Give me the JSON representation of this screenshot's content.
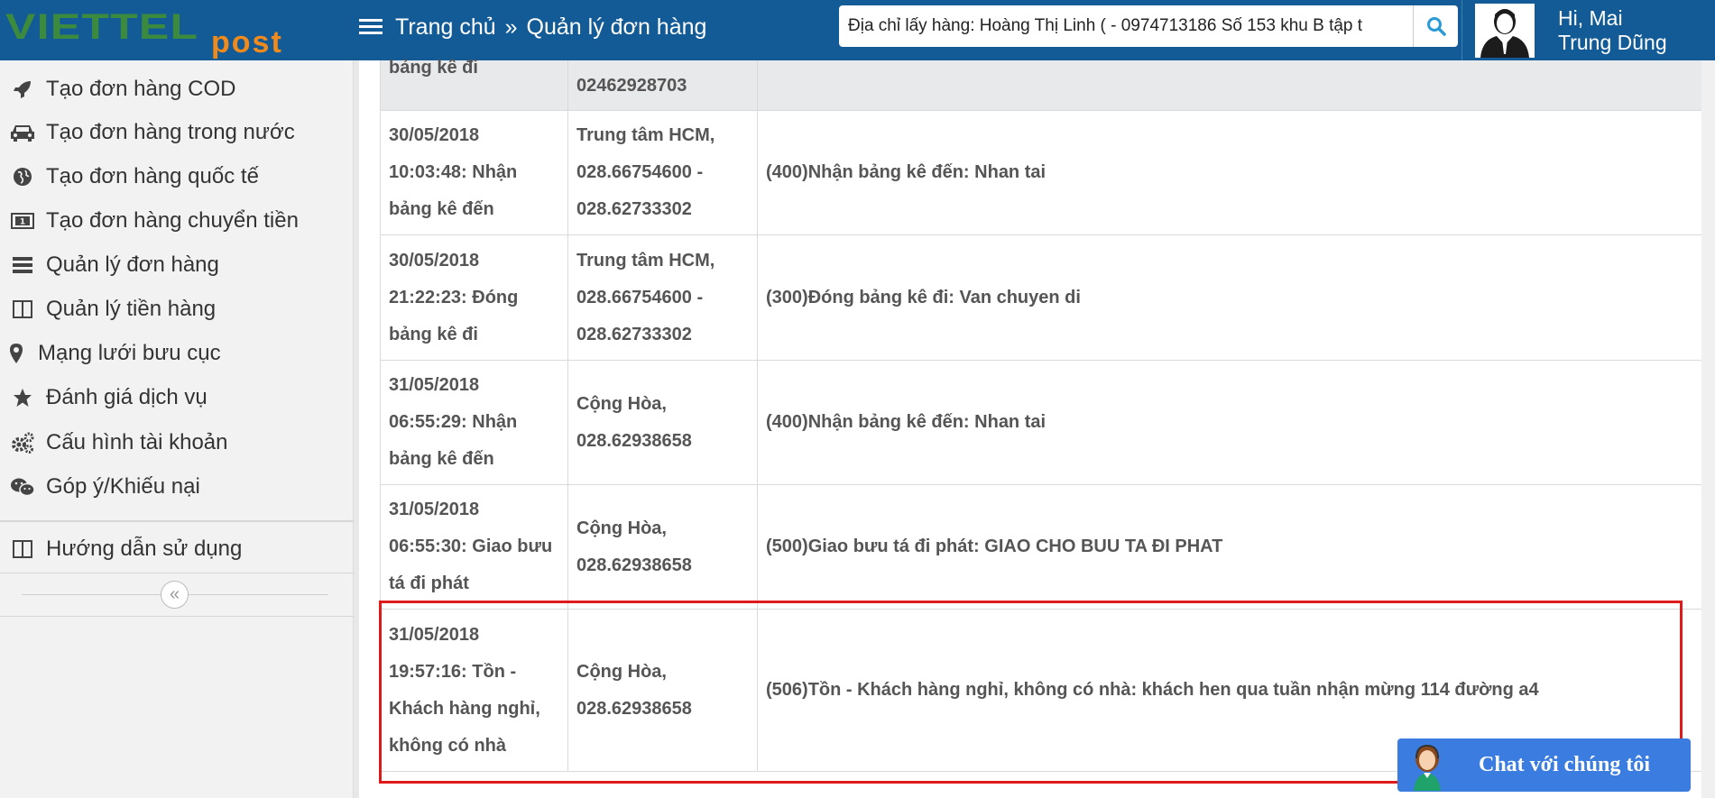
{
  "header": {
    "logo_primary": "VIETTEL",
    "logo_secondary": "post",
    "breadcrumb": [
      "Trang chủ",
      "Quản lý đơn hàng"
    ],
    "breadcrumb_sep": "»",
    "search_value": "Địa chỉ lấy hàng: Hoàng Thị Linh ( - 0974713186 Số 153 khu B tập t",
    "greeting_line1": "Hi, Mai",
    "greeting_line2": "Trung Dũng"
  },
  "sidebar": {
    "items": [
      {
        "label": "Tạo đơn hàng COD",
        "icon": "rocket-icon"
      },
      {
        "label": "Tạo đơn hàng trong nước",
        "icon": "car-icon"
      },
      {
        "label": "Tạo đơn hàng quốc tế",
        "icon": "globe-icon"
      },
      {
        "label": "Tạo đơn hàng chuyển tiền",
        "icon": "money-icon"
      },
      {
        "label": "Quản lý đơn hàng",
        "icon": "list-icon"
      },
      {
        "label": "Quản lý tiền hàng",
        "icon": "columns-icon"
      },
      {
        "label": "Mạng lưới bưu cục",
        "icon": "map-marker-icon"
      },
      {
        "label": "Đánh giá dịch vụ",
        "icon": "star-icon"
      },
      {
        "label": "Cấu hình tài khoản",
        "icon": "cogs-icon"
      },
      {
        "label": "Góp ý/Khiếu nại",
        "icon": "wechat-icon"
      }
    ],
    "guide": {
      "label": "Hướng dẫn sử dụng",
      "icon": "book-icon"
    },
    "collapse_glyph": "«"
  },
  "table": {
    "first_row": {
      "col1": "bảng kê đi",
      "col2": "02462928703",
      "col3": ""
    },
    "rows": [
      {
        "col1": [
          "30/05/2018",
          "10:03:48: Nhận",
          "bảng kê đến"
        ],
        "col2": [
          "Trung tâm HCM,",
          "028.66754600 -",
          "028.62733302"
        ],
        "col3": "(400)Nhận bảng kê đến: Nhan tai"
      },
      {
        "col1": [
          "30/05/2018",
          "21:22:23: Đóng",
          "bảng kê đi"
        ],
        "col2": [
          "Trung tâm HCM,",
          "028.66754600 -",
          "028.62733302"
        ],
        "col3": "(300)Đóng bảng kê đi: Van chuyen di"
      },
      {
        "col1": [
          "31/05/2018",
          "06:55:29: Nhận",
          "bảng kê đến"
        ],
        "col2": [
          "Cộng Hòa,",
          "028.62938658"
        ],
        "col3": "(400)Nhận bảng kê đến: Nhan tai"
      },
      {
        "col1": [
          "31/05/2018",
          "06:55:30: Giao bưu",
          "tá đi phát"
        ],
        "col2": [
          "Cộng Hòa,",
          "028.62938658"
        ],
        "col3": "(500)Giao bưu tá đi phát: GIAO CHO BUU TA ĐI PHAT"
      },
      {
        "col1": [
          "31/05/2018",
          "19:57:16: Tồn -",
          "Khách hàng nghỉ,",
          "không có nhà"
        ],
        "col2": [
          "Cộng Hòa,",
          "028.62938658"
        ],
        "col3": "(506)Tồn - Khách hàng nghỉ, không có nhà: khách hen qua tuần nhận mừng 114 đường a4"
      }
    ]
  },
  "chat": {
    "label": "Chat với chúng tôi"
  },
  "colors": {
    "header_bg": "#135b96",
    "highlight_border": "#e01a1a",
    "chat_bg": "#3a7cdf"
  }
}
